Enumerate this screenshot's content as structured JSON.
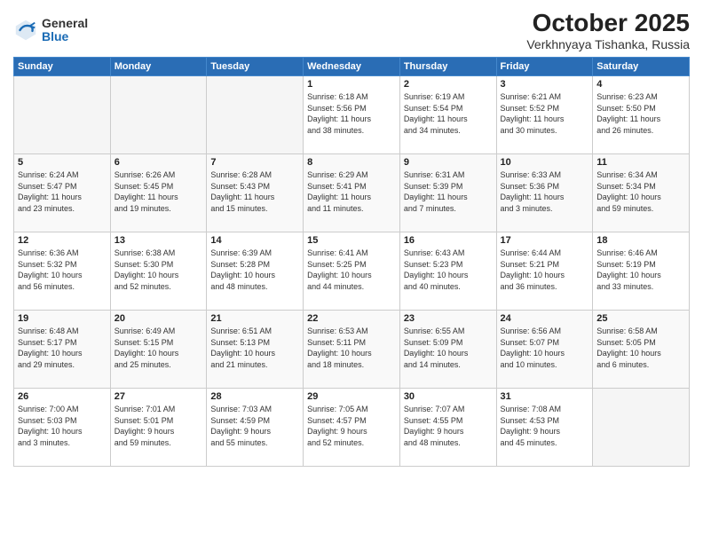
{
  "header": {
    "logo_general": "General",
    "logo_blue": "Blue",
    "month_year": "October 2025",
    "location": "Verkhnyaya Tishanka, Russia"
  },
  "weekdays": [
    "Sunday",
    "Monday",
    "Tuesday",
    "Wednesday",
    "Thursday",
    "Friday",
    "Saturday"
  ],
  "weeks": [
    [
      {
        "day": "",
        "info": ""
      },
      {
        "day": "",
        "info": ""
      },
      {
        "day": "",
        "info": ""
      },
      {
        "day": "1",
        "info": "Sunrise: 6:18 AM\nSunset: 5:56 PM\nDaylight: 11 hours\nand 38 minutes."
      },
      {
        "day": "2",
        "info": "Sunrise: 6:19 AM\nSunset: 5:54 PM\nDaylight: 11 hours\nand 34 minutes."
      },
      {
        "day": "3",
        "info": "Sunrise: 6:21 AM\nSunset: 5:52 PM\nDaylight: 11 hours\nand 30 minutes."
      },
      {
        "day": "4",
        "info": "Sunrise: 6:23 AM\nSunset: 5:50 PM\nDaylight: 11 hours\nand 26 minutes."
      }
    ],
    [
      {
        "day": "5",
        "info": "Sunrise: 6:24 AM\nSunset: 5:47 PM\nDaylight: 11 hours\nand 23 minutes."
      },
      {
        "day": "6",
        "info": "Sunrise: 6:26 AM\nSunset: 5:45 PM\nDaylight: 11 hours\nand 19 minutes."
      },
      {
        "day": "7",
        "info": "Sunrise: 6:28 AM\nSunset: 5:43 PM\nDaylight: 11 hours\nand 15 minutes."
      },
      {
        "day": "8",
        "info": "Sunrise: 6:29 AM\nSunset: 5:41 PM\nDaylight: 11 hours\nand 11 minutes."
      },
      {
        "day": "9",
        "info": "Sunrise: 6:31 AM\nSunset: 5:39 PM\nDaylight: 11 hours\nand 7 minutes."
      },
      {
        "day": "10",
        "info": "Sunrise: 6:33 AM\nSunset: 5:36 PM\nDaylight: 11 hours\nand 3 minutes."
      },
      {
        "day": "11",
        "info": "Sunrise: 6:34 AM\nSunset: 5:34 PM\nDaylight: 10 hours\nand 59 minutes."
      }
    ],
    [
      {
        "day": "12",
        "info": "Sunrise: 6:36 AM\nSunset: 5:32 PM\nDaylight: 10 hours\nand 56 minutes."
      },
      {
        "day": "13",
        "info": "Sunrise: 6:38 AM\nSunset: 5:30 PM\nDaylight: 10 hours\nand 52 minutes."
      },
      {
        "day": "14",
        "info": "Sunrise: 6:39 AM\nSunset: 5:28 PM\nDaylight: 10 hours\nand 48 minutes."
      },
      {
        "day": "15",
        "info": "Sunrise: 6:41 AM\nSunset: 5:25 PM\nDaylight: 10 hours\nand 44 minutes."
      },
      {
        "day": "16",
        "info": "Sunrise: 6:43 AM\nSunset: 5:23 PM\nDaylight: 10 hours\nand 40 minutes."
      },
      {
        "day": "17",
        "info": "Sunrise: 6:44 AM\nSunset: 5:21 PM\nDaylight: 10 hours\nand 36 minutes."
      },
      {
        "day": "18",
        "info": "Sunrise: 6:46 AM\nSunset: 5:19 PM\nDaylight: 10 hours\nand 33 minutes."
      }
    ],
    [
      {
        "day": "19",
        "info": "Sunrise: 6:48 AM\nSunset: 5:17 PM\nDaylight: 10 hours\nand 29 minutes."
      },
      {
        "day": "20",
        "info": "Sunrise: 6:49 AM\nSunset: 5:15 PM\nDaylight: 10 hours\nand 25 minutes."
      },
      {
        "day": "21",
        "info": "Sunrise: 6:51 AM\nSunset: 5:13 PM\nDaylight: 10 hours\nand 21 minutes."
      },
      {
        "day": "22",
        "info": "Sunrise: 6:53 AM\nSunset: 5:11 PM\nDaylight: 10 hours\nand 18 minutes."
      },
      {
        "day": "23",
        "info": "Sunrise: 6:55 AM\nSunset: 5:09 PM\nDaylight: 10 hours\nand 14 minutes."
      },
      {
        "day": "24",
        "info": "Sunrise: 6:56 AM\nSunset: 5:07 PM\nDaylight: 10 hours\nand 10 minutes."
      },
      {
        "day": "25",
        "info": "Sunrise: 6:58 AM\nSunset: 5:05 PM\nDaylight: 10 hours\nand 6 minutes."
      }
    ],
    [
      {
        "day": "26",
        "info": "Sunrise: 7:00 AM\nSunset: 5:03 PM\nDaylight: 10 hours\nand 3 minutes."
      },
      {
        "day": "27",
        "info": "Sunrise: 7:01 AM\nSunset: 5:01 PM\nDaylight: 9 hours\nand 59 minutes."
      },
      {
        "day": "28",
        "info": "Sunrise: 7:03 AM\nSunset: 4:59 PM\nDaylight: 9 hours\nand 55 minutes."
      },
      {
        "day": "29",
        "info": "Sunrise: 7:05 AM\nSunset: 4:57 PM\nDaylight: 9 hours\nand 52 minutes."
      },
      {
        "day": "30",
        "info": "Sunrise: 7:07 AM\nSunset: 4:55 PM\nDaylight: 9 hours\nand 48 minutes."
      },
      {
        "day": "31",
        "info": "Sunrise: 7:08 AM\nSunset: 4:53 PM\nDaylight: 9 hours\nand 45 minutes."
      },
      {
        "day": "",
        "info": ""
      }
    ]
  ]
}
